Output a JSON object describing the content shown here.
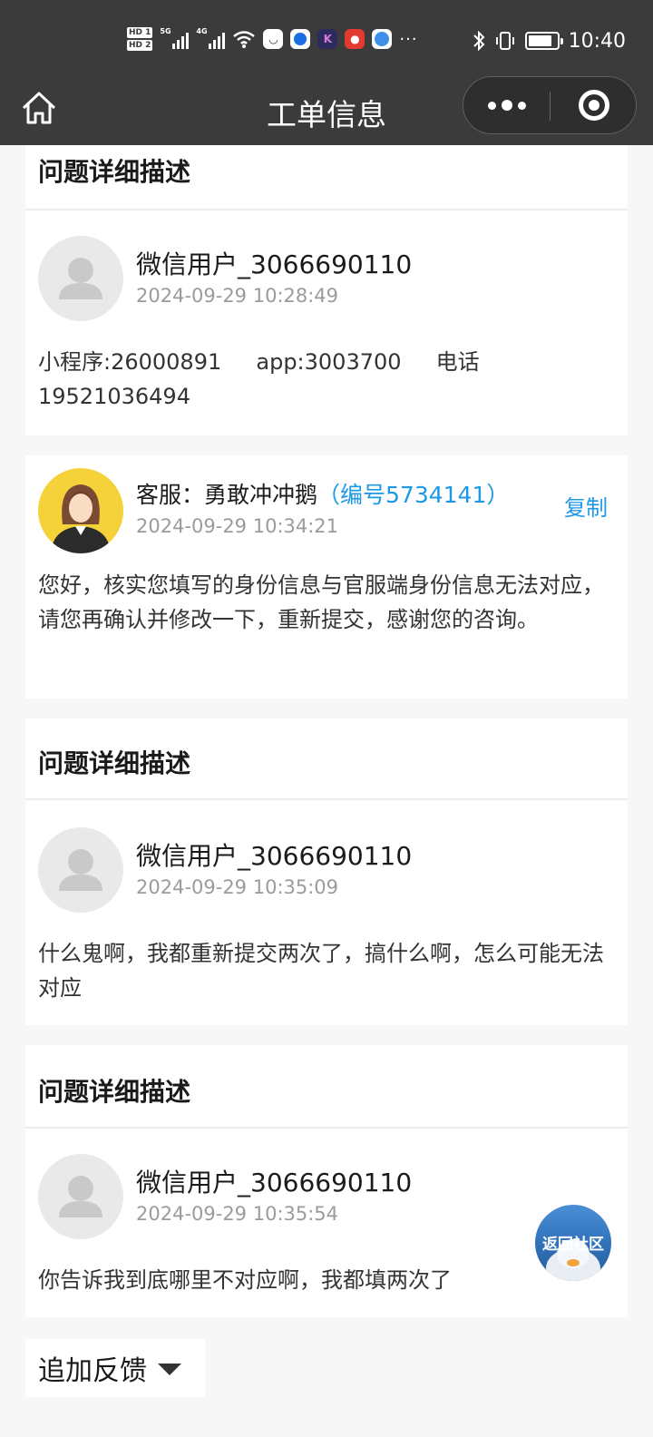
{
  "status_bar": {
    "hd_badges": [
      "HD 1",
      "HD 2"
    ],
    "signal_tags": [
      "5G",
      "4G"
    ],
    "app_icons": [
      "chat-icon",
      "circle-app-icon",
      "k-app-icon",
      "red-app-icon",
      "browser-icon"
    ],
    "more": "···",
    "time": "10:40"
  },
  "nav": {
    "title": "工单信息"
  },
  "sections": [
    {
      "title": "问题详细描述",
      "user": "微信用户_3066690110",
      "time": "2024-09-29 10:28:49",
      "message": "小程序:26000891     app:3003700     电话19521036494"
    },
    {
      "agent_label": "客服：勇敢冲冲鹅",
      "agent_id": "（编号5734141）",
      "copy": "复制",
      "time": "2024-09-29 10:34:21",
      "message": "您好，核实您填写的身份信息与官服端身份信息无法对应，请您再确认并修改一下，重新提交，感谢您的咨询。"
    },
    {
      "title": "问题详细描述",
      "user": "微信用户_3066690110",
      "time": "2024-09-29 10:35:09",
      "message": "什么鬼啊，我都重新提交两次了，搞什么啊，怎么可能无法对应"
    },
    {
      "title": "问题详细描述",
      "user": "微信用户_3066690110",
      "time": "2024-09-29 10:35:54",
      "message": "你告诉我到底哪里不对应啊，我都填两次了"
    }
  ],
  "float_button": "返回社区",
  "feedback": "追加反馈",
  "colors": {
    "topbar": "#3b3b3b",
    "accent_blue": "#1d98e6",
    "background": "#f7f7f7"
  }
}
